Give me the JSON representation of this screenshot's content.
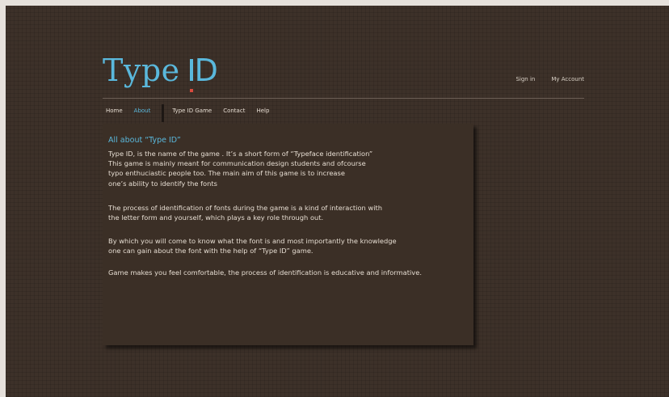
{
  "header": {
    "logo_text": "Type",
    "logo_id_text": "D",
    "top_links": [
      "Sign in",
      "My Account"
    ]
  },
  "nav": {
    "items": [
      "Home",
      "About",
      "Type ID Game",
      "Contact",
      "Help"
    ],
    "active": "About"
  },
  "content": {
    "title": "All about “Type ID”",
    "paragraphs": [
      "Type ID, is the name of the game . It’s a short form of “Typeface identification”\nThis game is mainly meant for communication design students and ofcourse\ntypo enthuciastic people too. The main aim of this game is to increase\none’s ability to identify the fonts",
      "The process of identification of fonts during the game is a kind of interaction with\nthe letter form and yourself, which plays a key role through out.",
      "By which you will come to know what the font is and most importantly the knowledge\none can gain about the font with the help of “Type ID” game.",
      "Game makes you feel comfortable, the process of identification is educative and informative."
    ]
  },
  "colors": {
    "accent": "#5ab8dc",
    "logo_dot": "#d94a3e",
    "background": "#3d3129",
    "panel": "#3b2f26",
    "text": "#e6ddd2",
    "frame": "#e6e1dc"
  }
}
